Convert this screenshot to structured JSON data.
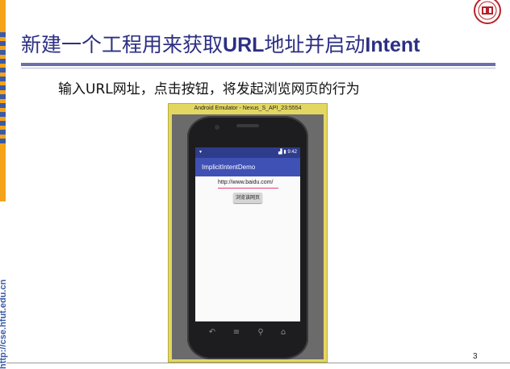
{
  "slide": {
    "title_zh_1": "新建一个工程用来获取",
    "title_en_1": "URL",
    "title_zh_2": "地址并启动",
    "title_en_2": "Intent",
    "description": "输入URL网址，点击按钮，将发起浏览网页的行为",
    "page_number": "3",
    "side_url": "http://cse.hfut.edu.cn"
  },
  "emulator": {
    "window_title": "Android Emulator - Nexus_S_API_23:5554",
    "status_time": "9:42",
    "app_title": "ImplicitIntentDemo",
    "url_value": "http://www.baidu.com/",
    "button_label": "浏览该网页"
  },
  "colors": {
    "title": "#2c2f83",
    "accent_orange": "#f4a31a",
    "app_bar": "#3f51b5",
    "status_bar": "#2e3c8c",
    "emulator_frame": "#e3d762"
  },
  "icons": [
    "download-icon",
    "signal-icon",
    "battery-icon",
    "back-icon",
    "home-icon",
    "search-icon",
    "menu-icon",
    "university-seal-icon"
  ]
}
